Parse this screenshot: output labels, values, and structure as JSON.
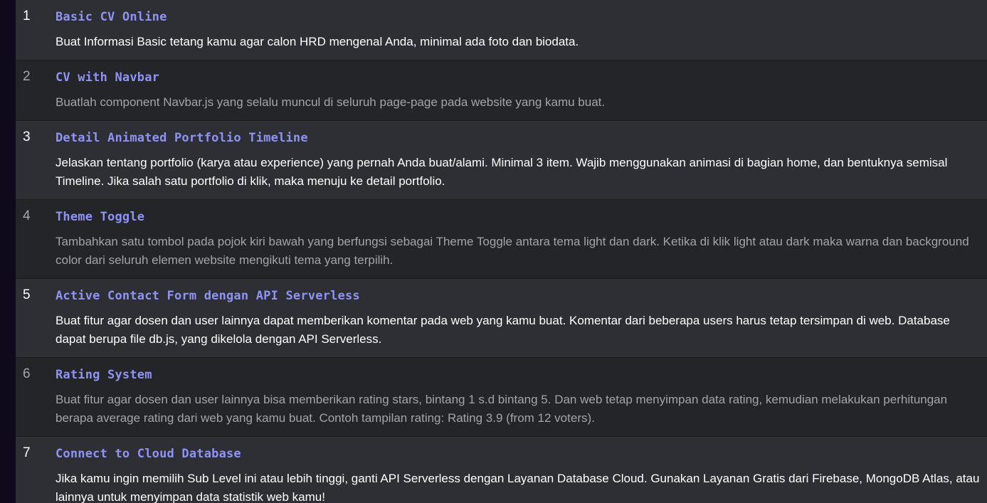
{
  "levels": [
    {
      "number": "1",
      "title": "Basic CV Online",
      "description": "Buat Informasi Basic tetang kamu agar calon HRD mengenal Anda, minimal ada foto dan biodata."
    },
    {
      "number": "2",
      "title": "CV with Navbar",
      "description": "Buatlah component Navbar.js yang selalu muncul di seluruh page-page pada website yang kamu buat."
    },
    {
      "number": "3",
      "title": "Detail Animated Portfolio Timeline",
      "description": "Jelaskan tentang portfolio (karya atau experience) yang pernah Anda buat/alami. Minimal 3 item. Wajib menggunakan animasi di bagian home, dan bentuknya semisal Timeline. Jika salah satu portfolio di klik, maka menuju ke detail portfolio."
    },
    {
      "number": "4",
      "title": "Theme Toggle",
      "description": "Tambahkan satu tombol pada pojok kiri bawah yang berfungsi sebagai Theme Toggle antara tema light dan dark. Ketika di klik light atau dark maka warna dan background color dari seluruh elemen website mengikuti tema yang terpilih."
    },
    {
      "number": "5",
      "title": "Active Contact Form dengan API Serverless",
      "description": "Buat fitur agar dosen dan user lainnya dapat memberikan komentar pada web yang kamu buat. Komentar dari beberapa users harus tetap tersimpan di web. Database dapat berupa file db.js, yang dikelola dengan API Serverless."
    },
    {
      "number": "6",
      "title": "Rating System",
      "description": "Buat fitur agar dosen dan user lainnya bisa memberikan rating stars, bintang 1 s.d bintang 5. Dan web tetap menyimpan data rating, kemudian melakukan perhitungan berapa average rating dari web yang kamu buat. Contoh tampilan rating: Rating 3.9 (from 12 voters)."
    },
    {
      "number": "7",
      "title": "Connect to Cloud Database",
      "description": "Jika kamu ingin memilih Sub Level ini atau lebih tinggi, ganti API Serverless dengan Layanan Database Cloud. Gunakan Layanan Gratis dari Firebase, MongoDB Atlas, atau lainnya untuk menyimpan data statistik web kamu!"
    }
  ]
}
